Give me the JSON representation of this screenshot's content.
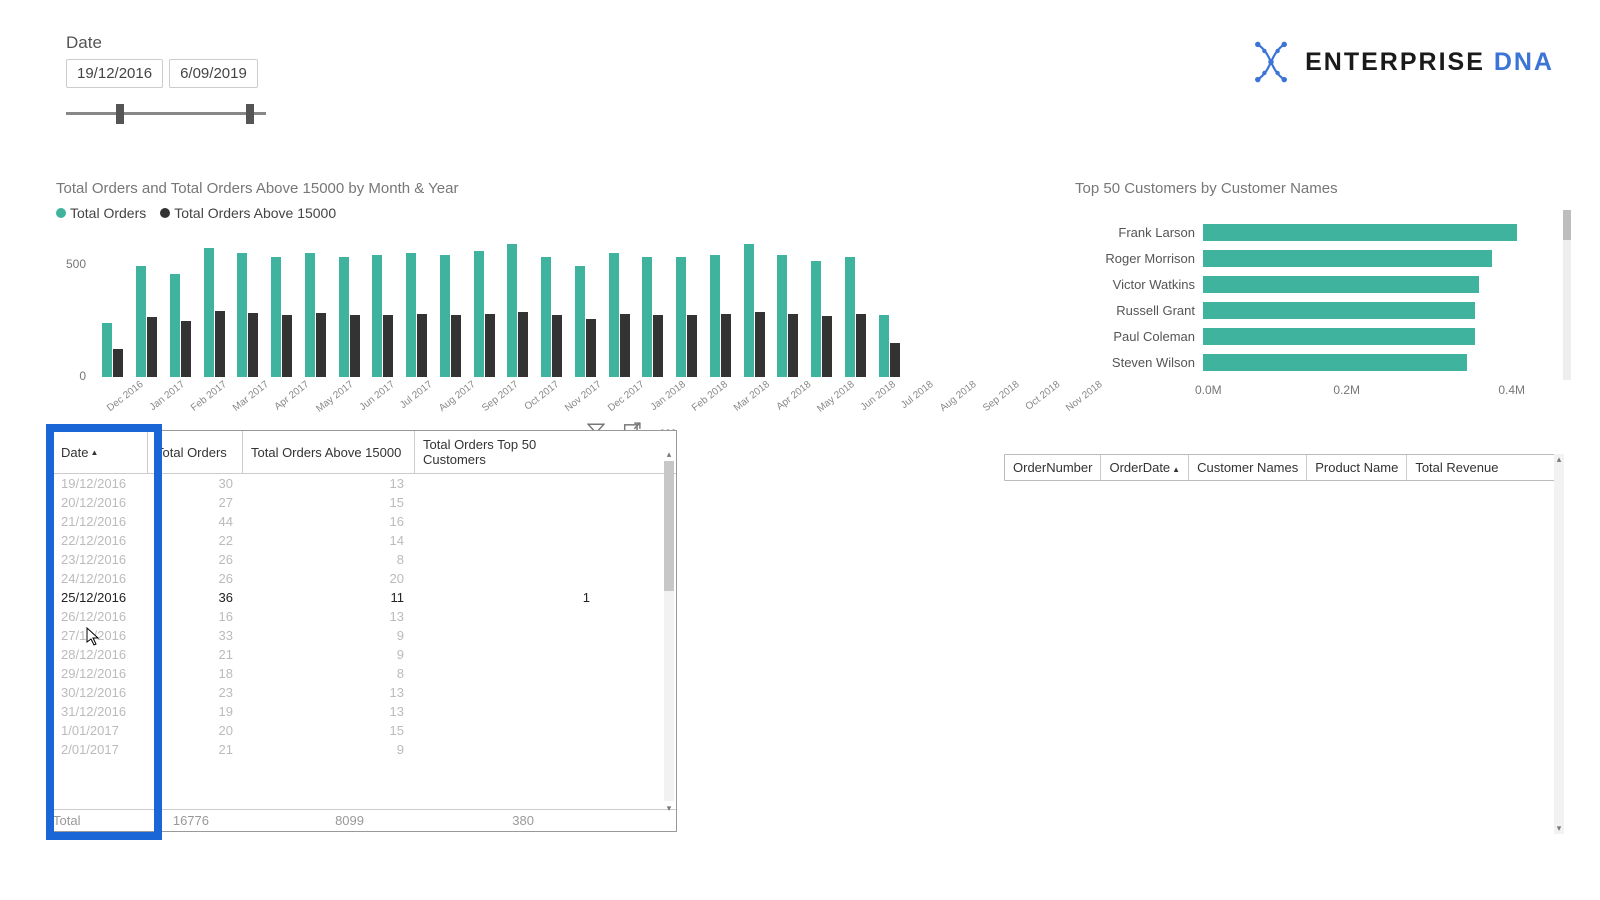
{
  "colors": {
    "teal": "#3fb39e",
    "dark": "#333333",
    "accent": "#1b66d6",
    "logoBlue": "#3b74d6"
  },
  "logo": {
    "brand": "ENTERPRISE",
    "suffix": "DNA"
  },
  "date_slicer": {
    "label": "Date",
    "start": "19/12/2016",
    "end": "6/09/2019",
    "handle_start_pct": 25,
    "handle_end_pct": 90
  },
  "chart_data": [
    {
      "type": "bar",
      "title": "Total Orders and Total Orders Above 15000 by Month & Year",
      "ylabel": "",
      "xlabel": "",
      "ylim": [
        0,
        700
      ],
      "yticks": [
        0,
        500
      ],
      "legend": [
        "Total Orders",
        "Total Orders Above 15000"
      ],
      "categories": [
        "Dec 2016",
        "Jan 2017",
        "Feb 2017",
        "Mar 2017",
        "Apr 2017",
        "May 2017",
        "Jun 2017",
        "Jul 2017",
        "Aug 2017",
        "Sep 2017",
        "Oct 2017",
        "Nov 2017",
        "Dec 2017",
        "Jan 2018",
        "Feb 2018",
        "Mar 2018",
        "Apr 2018",
        "May 2018",
        "Jun 2018",
        "Jul 2018",
        "Aug 2018",
        "Sep 2018",
        "Oct 2018",
        "Nov 2018"
      ],
      "series": [
        {
          "name": "Total Orders",
          "color": "#3fb39e",
          "values": [
            250,
            520,
            480,
            600,
            580,
            560,
            580,
            560,
            570,
            580,
            570,
            590,
            620,
            560,
            520,
            580,
            560,
            560,
            570,
            620,
            570,
            540,
            560,
            290
          ]
        },
        {
          "name": "Total Orders Above 15000",
          "color": "#333333",
          "values": [
            130,
            280,
            260,
            310,
            300,
            290,
            300,
            290,
            290,
            295,
            290,
            295,
            305,
            290,
            270,
            295,
            290,
            290,
            295,
            305,
            295,
            285,
            295,
            160
          ]
        }
      ]
    },
    {
      "type": "bar",
      "orientation": "horizontal",
      "title": "Top 50 Customers by Customer Names",
      "xlabel": "",
      "ylabel": "",
      "xlim": [
        0,
        400000
      ],
      "xticks": [
        "0.0M",
        "0.2M",
        "0.4M"
      ],
      "categories": [
        "Frank Larson",
        "Roger Morrison",
        "Victor Watkins",
        "Russell Grant",
        "Paul Coleman",
        "Steven Wilson"
      ],
      "values": [
        380000,
        350000,
        335000,
        330000,
        330000,
        320000
      ]
    }
  ],
  "bar_legend": {
    "s1": "Total Orders",
    "s2": "Total Orders Above 15000"
  },
  "matrix": {
    "headers": [
      "Date",
      "Total Orders",
      "Total Orders Above 15000",
      "Total Orders Top 50 Customers"
    ],
    "rows": [
      {
        "date": "19/12/2016",
        "to": "30",
        "ab": "13",
        "top": "",
        "active": false
      },
      {
        "date": "20/12/2016",
        "to": "27",
        "ab": "15",
        "top": "",
        "active": false
      },
      {
        "date": "21/12/2016",
        "to": "44",
        "ab": "16",
        "top": "",
        "active": false
      },
      {
        "date": "22/12/2016",
        "to": "22",
        "ab": "14",
        "top": "",
        "active": false
      },
      {
        "date": "23/12/2016",
        "to": "26",
        "ab": "8",
        "top": "",
        "active": false
      },
      {
        "date": "24/12/2016",
        "to": "26",
        "ab": "20",
        "top": "",
        "active": false
      },
      {
        "date": "25/12/2016",
        "to": "36",
        "ab": "11",
        "top": "1",
        "active": true
      },
      {
        "date": "26/12/2016",
        "to": "16",
        "ab": "13",
        "top": "",
        "active": false
      },
      {
        "date": "27/12/2016",
        "to": "33",
        "ab": "9",
        "top": "",
        "active": false
      },
      {
        "date": "28/12/2016",
        "to": "21",
        "ab": "9",
        "top": "",
        "active": false
      },
      {
        "date": "29/12/2016",
        "to": "18",
        "ab": "8",
        "top": "",
        "active": false
      },
      {
        "date": "30/12/2016",
        "to": "23",
        "ab": "13",
        "top": "",
        "active": false
      },
      {
        "date": "31/12/2016",
        "to": "19",
        "ab": "13",
        "top": "",
        "active": false
      },
      {
        "date": "1/01/2017",
        "to": "20",
        "ab": "15",
        "top": "",
        "active": false
      },
      {
        "date": "2/01/2017",
        "to": "21",
        "ab": "9",
        "top": "",
        "active": false
      }
    ],
    "total": {
      "label": "Total",
      "to": "16776",
      "ab": "8099",
      "top": "380"
    }
  },
  "rtable": {
    "headers": [
      "OrderNumber",
      "OrderDate",
      "Customer Names",
      "Product Name",
      "Total Revenue"
    ]
  }
}
